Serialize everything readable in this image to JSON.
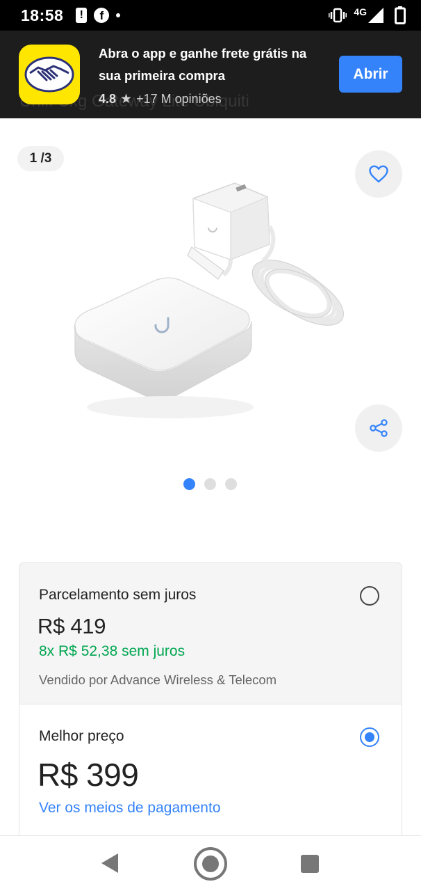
{
  "status_bar": {
    "time": "18:58",
    "network": "4G"
  },
  "app_banner": {
    "message": "Abra o app e ganhe frete grátis na sua primeira compra",
    "rating": "4.8",
    "reviews": "+17 M opiniões",
    "open_label": "Abrir",
    "background_title": "Unifi Cxg Gateway Lite Ubiquiti"
  },
  "gallery": {
    "counter": "1 /3",
    "pages": 3,
    "active_page": 1
  },
  "purchase_options": {
    "installments": {
      "title": "Parcelamento sem juros",
      "price": "R$ 419",
      "installment": "8x R$ 52,38 sem juros",
      "seller": "Vendido por Advance Wireless & Telecom",
      "selected": false
    },
    "best_price": {
      "title": "Melhor preço",
      "price": "R$ 399",
      "link": "Ver os meios de pagamento",
      "selected": true
    }
  },
  "colors": {
    "accent": "#3483fa",
    "success": "#00a650",
    "brand_yellow": "#ffe600",
    "banner_bg": "#1d1d1d"
  }
}
